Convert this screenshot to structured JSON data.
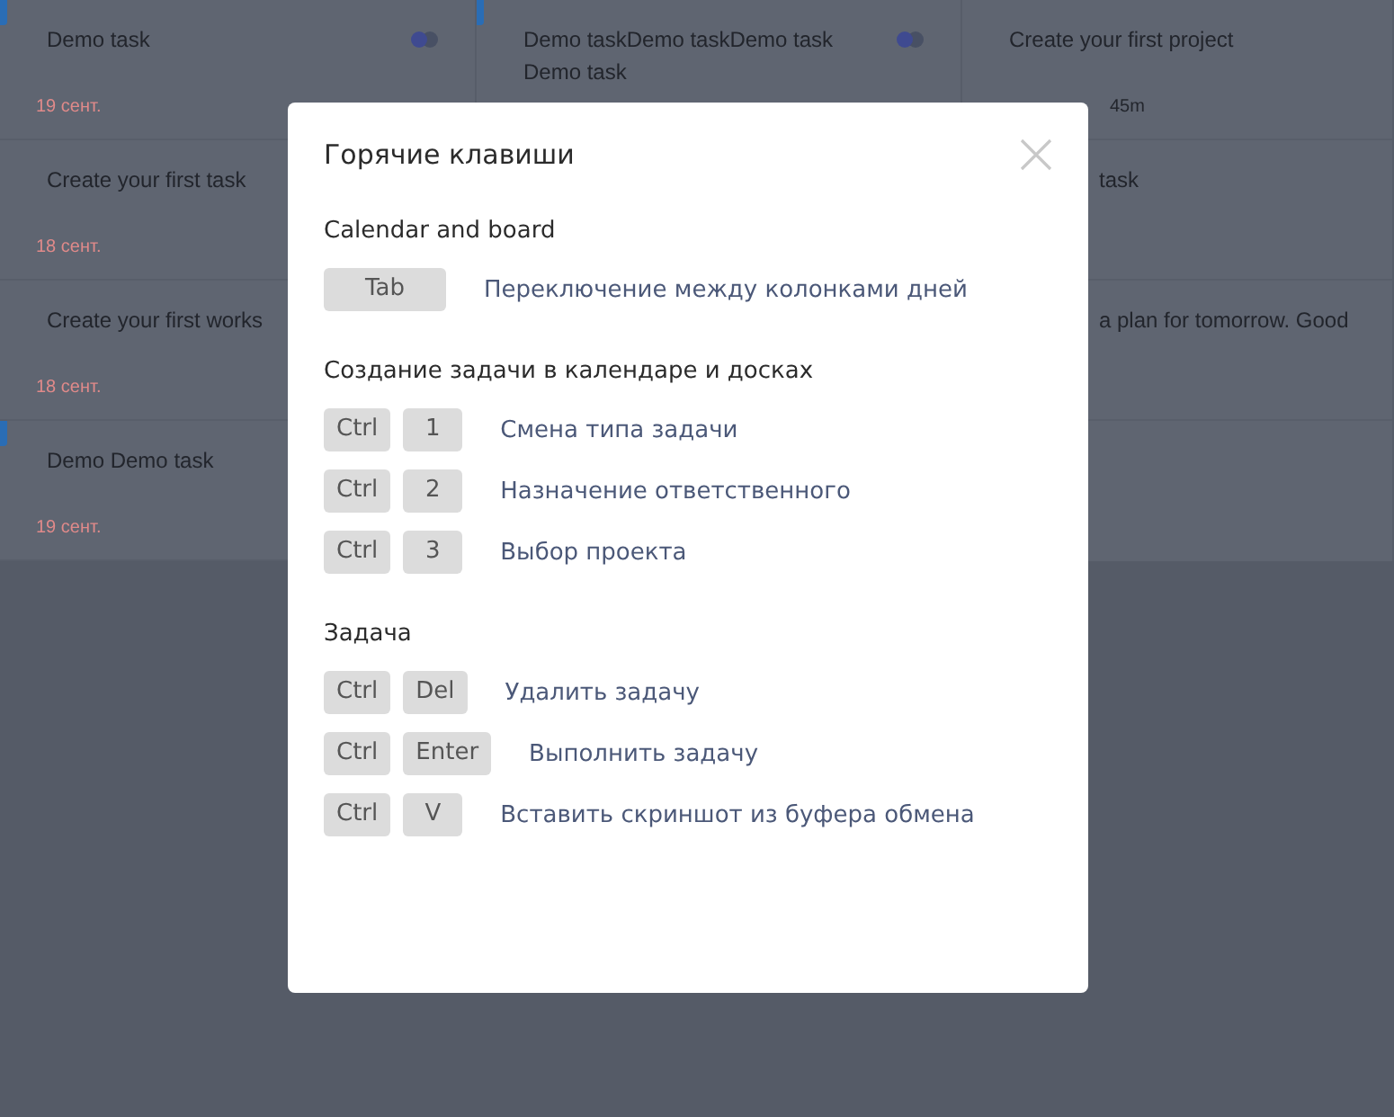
{
  "board": {
    "columns": [
      {
        "cards": [
          {
            "title": "Demo task",
            "date": "19 сент.",
            "color": "#2a6db5",
            "kind": "toggle"
          },
          {
            "title": "Create your first task",
            "date": "18 сент."
          },
          {
            "title": "Create your first works",
            "date": "18 сент."
          },
          {
            "title": "Demo Demo task",
            "date": "19 сент.",
            "color": "#2a6db5"
          }
        ]
      },
      {
        "cards": [
          {
            "title": "Demo taskDemo taskDemo task Demo task",
            "color": "#2a6db5",
            "kind": "toggle"
          }
        ]
      },
      {
        "cards": [
          {
            "title": "Create your first project",
            "duration": "45m"
          },
          {
            "title": "task",
            "kind": "partial"
          },
          {
            "title": "a plan for tomorrow. Good",
            "kind": "partial"
          }
        ]
      }
    ]
  },
  "dialog": {
    "title": "Горячие клавиши",
    "sections": [
      {
        "title": "Calendar and board",
        "shortcuts": [
          {
            "keys": [
              "Tab"
            ],
            "description": "Переключение между колонками дней"
          }
        ]
      },
      {
        "title": "Создание задачи в календаре и досках",
        "shortcuts": [
          {
            "keys": [
              "Ctrl",
              "1"
            ],
            "description": "Смена типа задачи"
          },
          {
            "keys": [
              "Ctrl",
              "2"
            ],
            "description": "Назначение ответственного"
          },
          {
            "keys": [
              "Ctrl",
              "3"
            ],
            "description": "Выбор проекта"
          }
        ]
      },
      {
        "title": "Задача",
        "shortcuts": [
          {
            "keys": [
              "Ctrl",
              "Del"
            ],
            "description": "Удалить задачу"
          },
          {
            "keys": [
              "Ctrl",
              "Enter"
            ],
            "description": "Выполнить задачу"
          },
          {
            "keys": [
              "Ctrl",
              "V"
            ],
            "description": "Вставить скриншот из буфера обмена"
          }
        ]
      }
    ]
  }
}
